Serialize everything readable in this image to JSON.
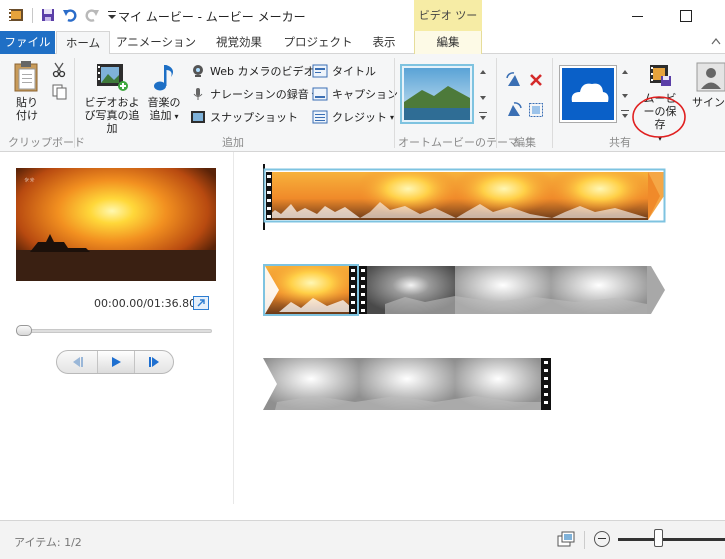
{
  "window": {
    "title": "マイ ムービー - ムービー メーカー",
    "context_tab_group": "ビデオ ツール"
  },
  "tabs": [
    "ファイル",
    "ホーム",
    "アニメーション",
    "視覚効果",
    "プロジェクト",
    "表示",
    "編集"
  ],
  "ribbon": {
    "clipboard": {
      "paste": "貼り付け",
      "label": "クリップボード"
    },
    "add": {
      "add_videos_photos": "ビデオおよび写真の追加",
      "add_music": "音楽の追加",
      "webcam_video": "Web カメラのビデオ",
      "record_narration": "ナレーションの録音",
      "snapshot": "スナップショット",
      "title": "タイトル",
      "caption": "キャプション",
      "credits": "クレジット",
      "label": "追加"
    },
    "automovie": {
      "label": "オートムービーのテーマ"
    },
    "editing": {
      "label": "編集"
    },
    "sharing": {
      "save_movie": "ムービーの保存",
      "sign_in": "サインイ",
      "label": "共有"
    }
  },
  "preview": {
    "timecode": "00:00.00/01:36.80",
    "seek_position": 0
  },
  "status": {
    "items": "アイテム: 1/2",
    "zoom_position": 0.38
  },
  "colors": {
    "file_tab": "#1f6fc5",
    "context_tab": "#f6eca5",
    "selection": "#7ec3e0",
    "annotation_circle": "#e02020"
  }
}
